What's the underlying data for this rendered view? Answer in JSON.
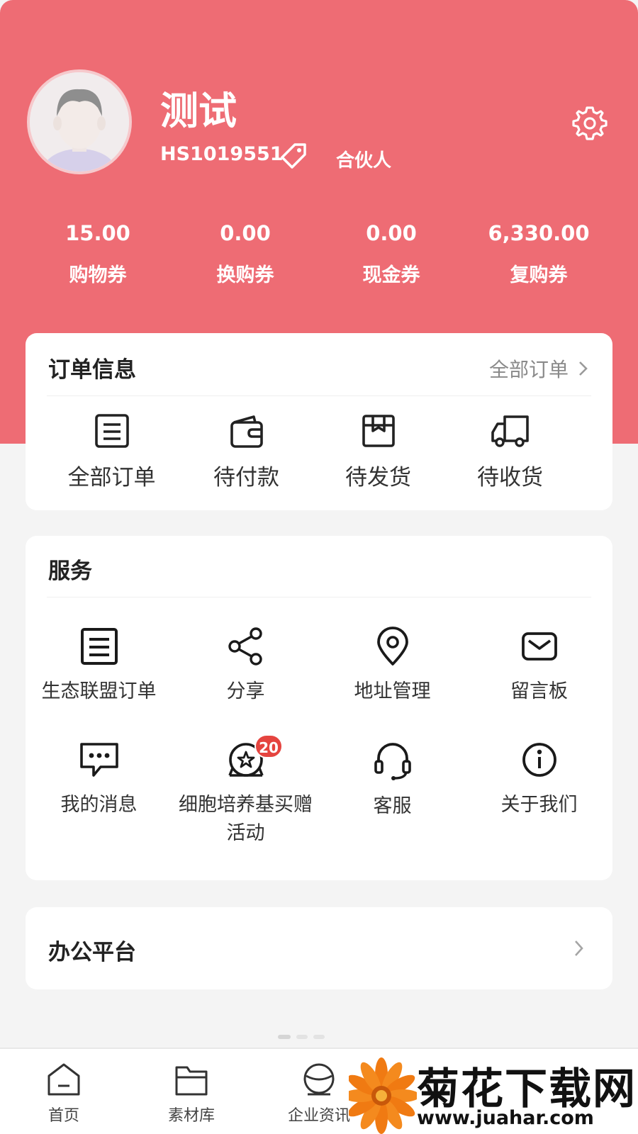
{
  "profile": {
    "name": "测试",
    "id": "HS1019551",
    "role": "合伙人"
  },
  "stats": [
    {
      "value": "15.00",
      "label": "购物券"
    },
    {
      "value": "0.00",
      "label": "换购券"
    },
    {
      "value": "0.00",
      "label": "现金券"
    },
    {
      "value": "6,330.00",
      "label": "复购券"
    }
  ],
  "orders": {
    "title": "订单信息",
    "all_link": "全部订单",
    "items": [
      {
        "label": "全部订单",
        "icon": "order-list-icon"
      },
      {
        "label": "待付款",
        "icon": "wallet-icon"
      },
      {
        "label": "待发货",
        "icon": "box-icon"
      },
      {
        "label": "待收货",
        "icon": "truck-icon"
      }
    ]
  },
  "services": {
    "title": "服务",
    "items": [
      {
        "label": "生态联盟订单",
        "icon": "order-list-icon"
      },
      {
        "label": "分享",
        "icon": "share-icon"
      },
      {
        "label": "地址管理",
        "icon": "location-pin-icon"
      },
      {
        "label": "留言板",
        "icon": "mail-icon"
      },
      {
        "label": "我的消息",
        "icon": "chat-bubble-icon"
      },
      {
        "label": "细胞培养基买赠活动",
        "label_line2": "活动",
        "label_line1": "细胞培养基买赠",
        "icon": "star-gift-icon",
        "badge": "20"
      },
      {
        "label": "客服",
        "icon": "headset-icon"
      },
      {
        "label": "关于我们",
        "icon": "info-icon"
      }
    ]
  },
  "office": {
    "title": "办公平台"
  },
  "tabs": [
    {
      "label": "首页",
      "icon": "home-icon"
    },
    {
      "label": "素材库",
      "icon": "folder-icon"
    },
    {
      "label": "企业资讯",
      "icon": "globe-icon"
    }
  ],
  "watermark": {
    "text": "菊花下载网",
    "url": "www.juahar.com"
  },
  "colors": {
    "header": "#ee6c74",
    "badge": "#e5443f",
    "background": "#f4f4f4"
  }
}
